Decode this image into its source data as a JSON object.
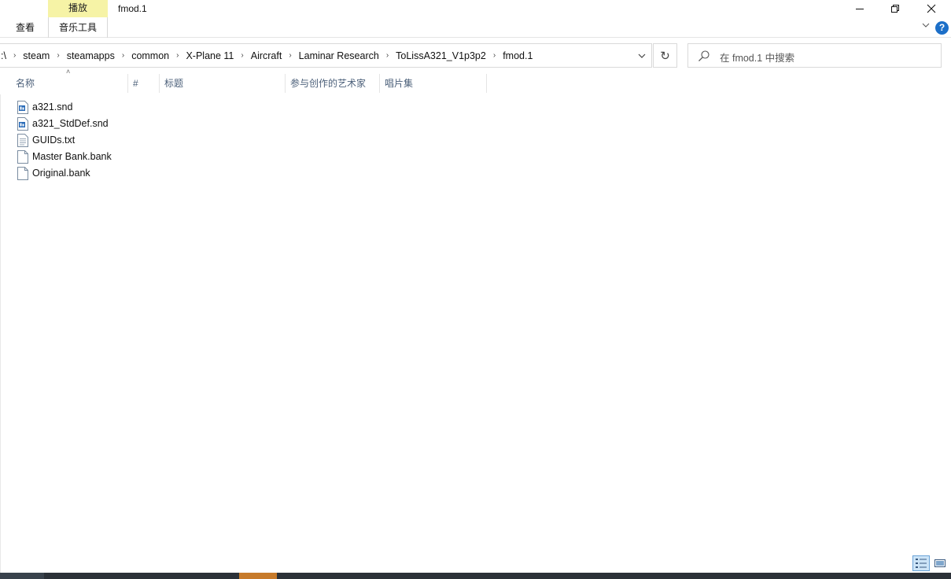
{
  "window": {
    "title": "fmod.1",
    "contextual_tab_header": "播放",
    "contextual_tab_color": "#f6f3a6"
  },
  "ribbon": {
    "tabs": [
      {
        "label": "查看"
      },
      {
        "label": "音乐工具"
      }
    ],
    "help_glyph": "?"
  },
  "address": {
    "breadcrumbs": [
      ":\\",
      "steam",
      "steamapps",
      "common",
      "X-Plane 11",
      "Aircraft",
      "Laminar Research",
      "ToLissA321_V1p3p2",
      "fmod.1"
    ]
  },
  "search": {
    "placeholder": "在 fmod.1 中搜索"
  },
  "columns": [
    {
      "label": "名称"
    },
    {
      "label": "#"
    },
    {
      "label": "标题"
    },
    {
      "label": "参与创作的艺术家"
    },
    {
      "label": "唱片集"
    }
  ],
  "files": [
    {
      "name": "a321.snd",
      "icon": "snd-file-icon"
    },
    {
      "name": "a321_StdDef.snd",
      "icon": "snd-file-icon"
    },
    {
      "name": "GUIDs.txt",
      "icon": "text-file-icon"
    },
    {
      "name": "Master Bank.bank",
      "icon": "blank-file-icon"
    },
    {
      "name": "Original.bank",
      "icon": "blank-file-icon"
    }
  ],
  "colors": {
    "accent": "#1c6fc8",
    "header_text": "#4c607a",
    "taskbar": "#2b3138",
    "selected_view": "#cce4f7"
  }
}
